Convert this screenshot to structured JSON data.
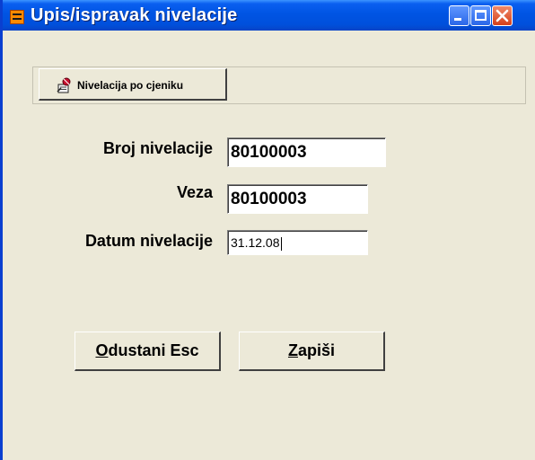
{
  "window": {
    "title": "Upis/ispravak nivelacije",
    "controls": [
      "minimize-icon",
      "maximize-icon",
      "close-icon"
    ]
  },
  "toolbar": {
    "button_label": "Nivelacija po cjeniku",
    "button_icon": "price-list-icon"
  },
  "form": {
    "broj_label": "Broj nivelacije",
    "broj_value": "80100003",
    "veza_label": "Veza",
    "veza_value": "80100003",
    "datum_label": "Datum nivelacije",
    "datum_value": "31.12.08"
  },
  "buttons": {
    "cancel_mnemonic": "O",
    "cancel_rest": "dustani Esc",
    "save_mnemonic": "Z",
    "save_rest": "apiši"
  },
  "colors": {
    "titlebar": "#0054e3",
    "background": "#ece9d8",
    "close_button": "#d5401a"
  }
}
